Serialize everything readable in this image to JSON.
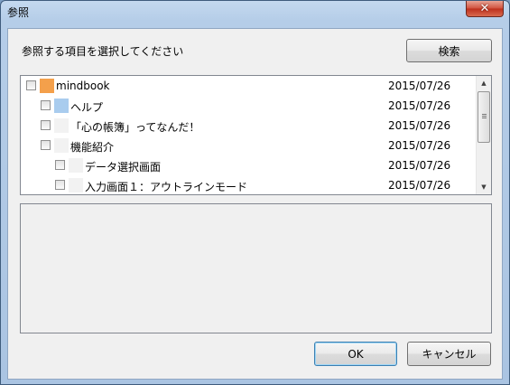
{
  "window": {
    "title": "参照",
    "close_glyph": "✕"
  },
  "dialog": {
    "prompt": "参照する項目を選択してください"
  },
  "buttons": {
    "search": "検索",
    "ok": "OK",
    "cancel": "キャンセル"
  },
  "tree": {
    "items": [
      {
        "label": "mindbook",
        "date": "2015/07/26",
        "icon": "orange-square-icon",
        "color": "#f4a04b",
        "checked": false
      },
      {
        "label": "ヘルプ",
        "date": "2015/07/26",
        "icon": "blue-square-icon",
        "color": "#a9ccee",
        "checked": false
      },
      {
        "label": "「心の帳簿」ってなんだ！",
        "date": "2015/07/26",
        "icon": "blank-page-icon",
        "color": "#f2f2f2",
        "checked": false
      },
      {
        "label": "機能紹介",
        "date": "2015/07/26",
        "icon": "blank-page-icon",
        "color": "#f2f2f2",
        "checked": false
      },
      {
        "label": "データ選択画面",
        "date": "2015/07/26",
        "icon": "blank-page-icon",
        "color": "#f2f2f2",
        "checked": false
      },
      {
        "label": "入力画面１：アウトラインモード",
        "date": "2015/07/26",
        "icon": "blank-page-icon",
        "color": "#f2f2f2",
        "checked": false
      }
    ]
  },
  "scrollbar": {
    "up_glyph": "▲",
    "down_glyph": "▼"
  }
}
